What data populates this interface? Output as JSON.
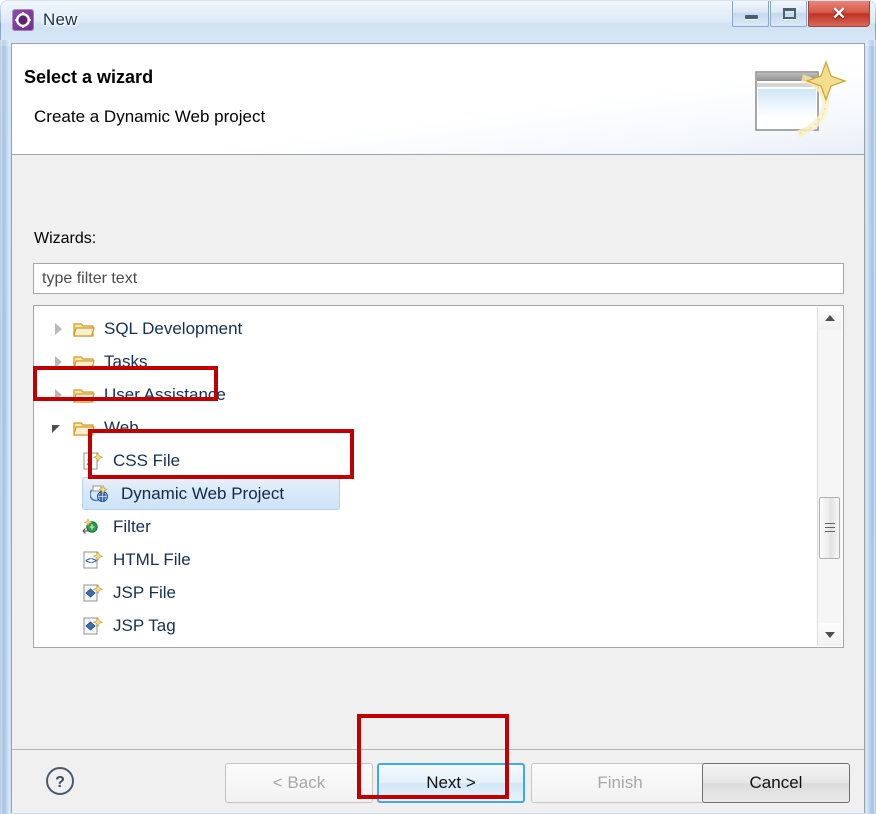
{
  "window": {
    "title": "New",
    "icon": "eclipse-new-wizard-icon",
    "controls": {
      "minimize": "minimize-icon",
      "maximize": "maximize-icon",
      "close": "✕"
    }
  },
  "banner": {
    "title": "Select a wizard",
    "subtitle": "Create a Dynamic Web project",
    "icon": "wizard-banner-icon"
  },
  "form": {
    "wizards_label": "Wizards:",
    "filter_placeholder": "type filter text",
    "filter_value": ""
  },
  "tree": {
    "items": [
      {
        "label": "SQL Development",
        "level": 0,
        "state": "collapsed",
        "icon": "folder-icon",
        "selected": false
      },
      {
        "label": "Tasks",
        "level": 0,
        "state": "collapsed",
        "icon": "folder-icon",
        "selected": false
      },
      {
        "label": "User Assistance",
        "level": 0,
        "state": "collapsed",
        "icon": "folder-icon",
        "selected": false
      },
      {
        "label": "Web",
        "level": 0,
        "state": "expanded",
        "icon": "folder-open-icon",
        "selected": false
      },
      {
        "label": "CSS File",
        "level": 1,
        "state": "leaf",
        "icon": "css-file-icon",
        "selected": false
      },
      {
        "label": "Dynamic Web Project",
        "level": 1,
        "state": "leaf",
        "icon": "dynamic-web-project-icon",
        "selected": true
      },
      {
        "label": "Filter",
        "level": 1,
        "state": "leaf",
        "icon": "filter-icon",
        "selected": false
      },
      {
        "label": "HTML File",
        "level": 1,
        "state": "leaf",
        "icon": "html-file-icon",
        "selected": false
      },
      {
        "label": "JSP File",
        "level": 1,
        "state": "leaf",
        "icon": "jsp-file-icon",
        "selected": false
      },
      {
        "label": "JSP Tag",
        "level": 1,
        "state": "leaf",
        "icon": "jsp-tag-icon",
        "selected": false
      }
    ],
    "scrollbar": {
      "up_arrow": "scroll-up-icon",
      "down_arrow": "scroll-down-icon",
      "thumb_position_percent": 60
    }
  },
  "footer": {
    "help": "?",
    "back_label": "< Back",
    "back_enabled": false,
    "next_label": "Next >",
    "next_enabled": true,
    "next_default": true,
    "finish_label": "Finish",
    "finish_enabled": false,
    "cancel_label": "Cancel",
    "cancel_enabled": true
  },
  "annotations": {
    "color": "#C00000",
    "boxes": [
      "web-tree-item",
      "dynamic-web-project-tree-item",
      "next-button"
    ]
  }
}
